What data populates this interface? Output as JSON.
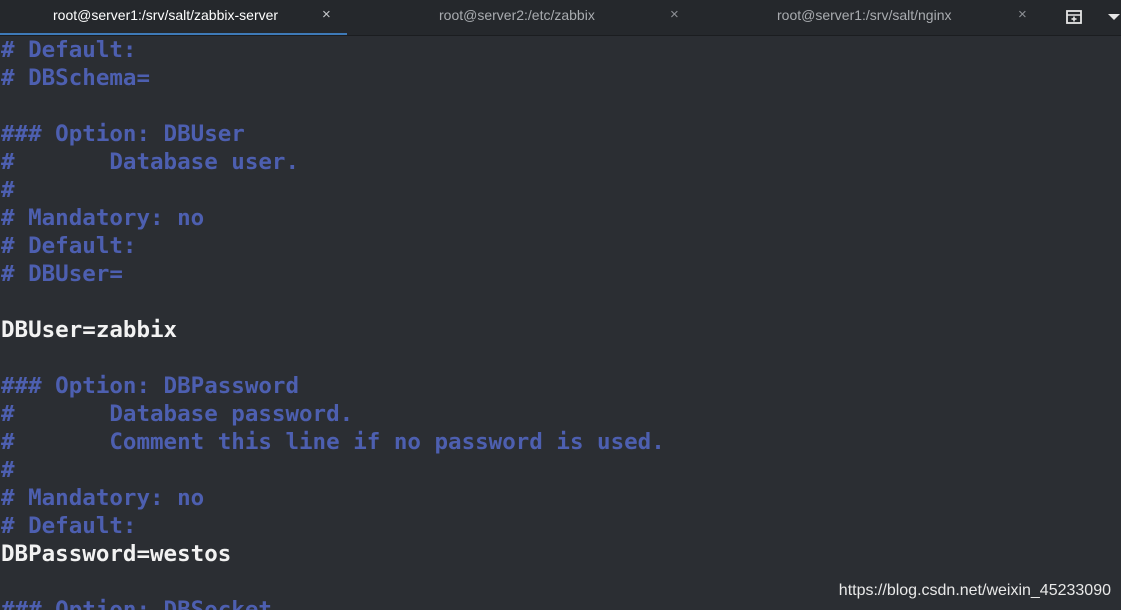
{
  "tabs": [
    {
      "label": "root@server1:/srv/salt/zabbix-server",
      "close": "×",
      "active": true
    },
    {
      "label": "root@server2:/etc/zabbix",
      "close": "×",
      "active": false
    },
    {
      "label": "root@server1:/srv/salt/nginx",
      "close": "×",
      "active": false
    }
  ],
  "toolbar": {
    "new_tab_icon": "new-tab-icon",
    "menu_icon": "chevron-down-icon"
  },
  "terminal": {
    "lines": [
      {
        "text": "# Default:",
        "kind": "comment"
      },
      {
        "text": "# DBSchema=",
        "kind": "comment"
      },
      {
        "text": "",
        "kind": "comment"
      },
      {
        "text": "### Option: DBUser",
        "kind": "comment"
      },
      {
        "text": "#       Database user.",
        "kind": "comment"
      },
      {
        "text": "#",
        "kind": "comment"
      },
      {
        "text": "# Mandatory: no",
        "kind": "comment"
      },
      {
        "text": "# Default:",
        "kind": "comment"
      },
      {
        "text": "# DBUser=",
        "kind": "comment"
      },
      {
        "text": "",
        "kind": "comment"
      },
      {
        "text": "DBUser=zabbix",
        "kind": "code"
      },
      {
        "text": "",
        "kind": "comment"
      },
      {
        "text": "### Option: DBPassword",
        "kind": "comment"
      },
      {
        "text": "#       Database password.",
        "kind": "comment"
      },
      {
        "text": "#       Comment this line if no password is used.",
        "kind": "comment"
      },
      {
        "text": "#",
        "kind": "comment"
      },
      {
        "text": "# Mandatory: no",
        "kind": "comment"
      },
      {
        "text": "# Default:",
        "kind": "comment"
      },
      {
        "text": "DBPassword=westos",
        "kind": "code"
      },
      {
        "text": "",
        "kind": "comment"
      },
      {
        "text": "### Option: DBSocket",
        "kind": "comment"
      }
    ]
  },
  "watermark": "https://blog.csdn.net/weixin_45233090",
  "colors": {
    "background": "#2b2e33",
    "comment": "#4d5fb0",
    "code": "#f2f2f2",
    "active_tab_underline": "#3e7ab8"
  }
}
